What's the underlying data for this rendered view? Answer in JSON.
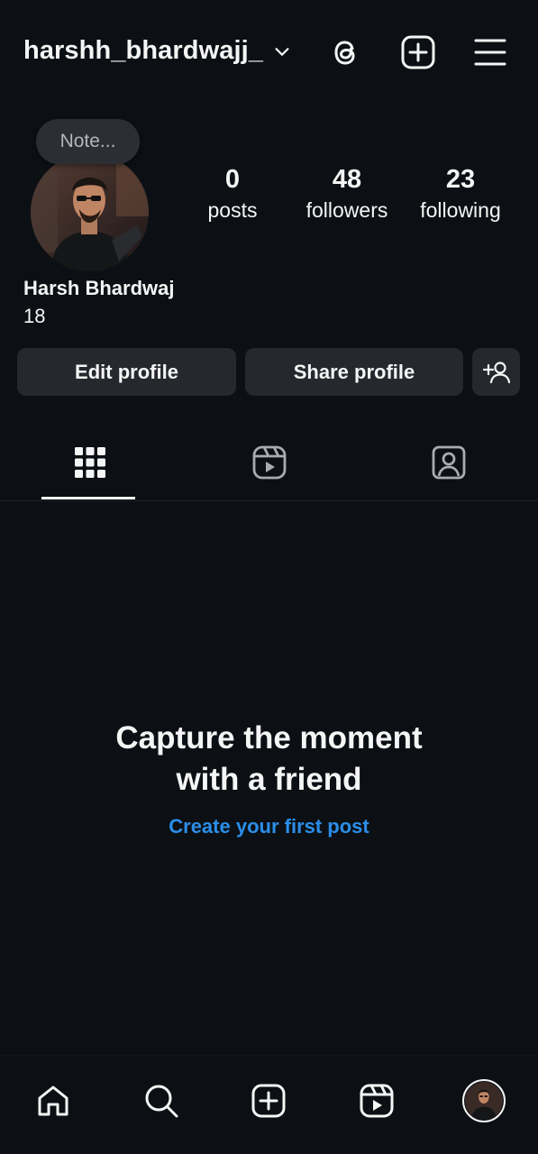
{
  "header": {
    "username": "harshh_bhardwajj_",
    "icons": [
      "chevron-down-icon",
      "threads-icon",
      "create-icon",
      "menu-icon"
    ]
  },
  "profile": {
    "note_placeholder": "Note...",
    "full_name": "Harsh Bhardwaj",
    "bio": "18",
    "stats": [
      {
        "value": "0",
        "label": "posts"
      },
      {
        "value": "48",
        "label": "followers"
      },
      {
        "value": "23",
        "label": "following"
      }
    ]
  },
  "actions": {
    "edit_label": "Edit profile",
    "share_label": "Share profile"
  },
  "tabs": [
    "grid-icon",
    "reels-icon",
    "tagged-icon"
  ],
  "empty_state": {
    "title_line1": "Capture the moment",
    "title_line2": "with a friend",
    "link": "Create your first post"
  },
  "bottom_nav": [
    "home-icon",
    "search-icon",
    "create-icon",
    "reels-icon",
    "profile-avatar"
  ],
  "colors": {
    "background": "#0c1014",
    "button": "#25292e",
    "link": "#2b8ee9",
    "text": "#f5f5f5"
  }
}
